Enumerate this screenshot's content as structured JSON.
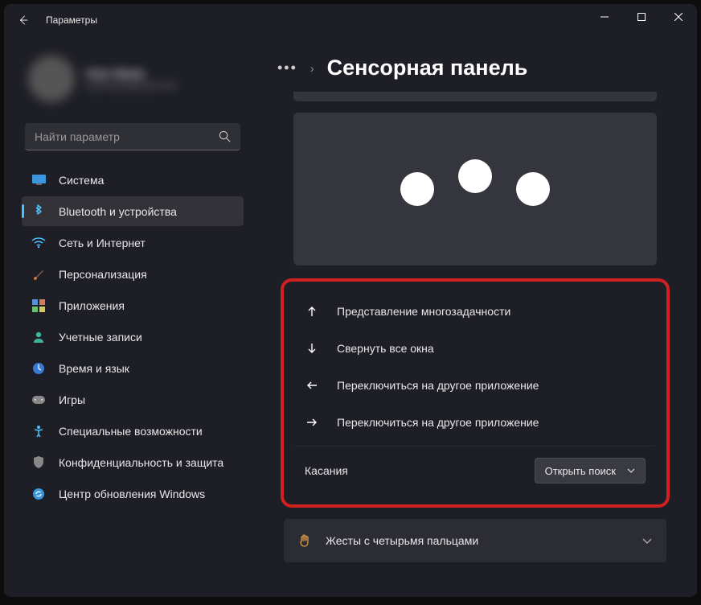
{
  "window": {
    "title": "Параметры"
  },
  "profile": {
    "name": "User Name",
    "email": "username@mail.com"
  },
  "search": {
    "placeholder": "Найти параметр"
  },
  "nav": {
    "items": [
      {
        "label": "Система"
      },
      {
        "label": "Bluetooth и устройства"
      },
      {
        "label": "Сеть и Интернет"
      },
      {
        "label": "Персонализация"
      },
      {
        "label": "Приложения"
      },
      {
        "label": "Учетные записи"
      },
      {
        "label": "Время и язык"
      },
      {
        "label": "Игры"
      },
      {
        "label": "Специальные возможности"
      },
      {
        "label": "Конфиденциальность и защита"
      },
      {
        "label": "Центр обновления Windows"
      }
    ],
    "active_index": 1
  },
  "breadcrumb": {
    "title": "Сенсорная панель"
  },
  "gestures": {
    "rows": [
      {
        "label": "Представление многозадачности"
      },
      {
        "label": "Свернуть все окна"
      },
      {
        "label": "Переключиться на другое приложение"
      },
      {
        "label": "Переключиться на другое приложение"
      }
    ],
    "tap_label": "Касания",
    "tap_dropdown": "Открыть поиск"
  },
  "four_finger": {
    "label": "Жесты с четырьмя пальцами"
  }
}
